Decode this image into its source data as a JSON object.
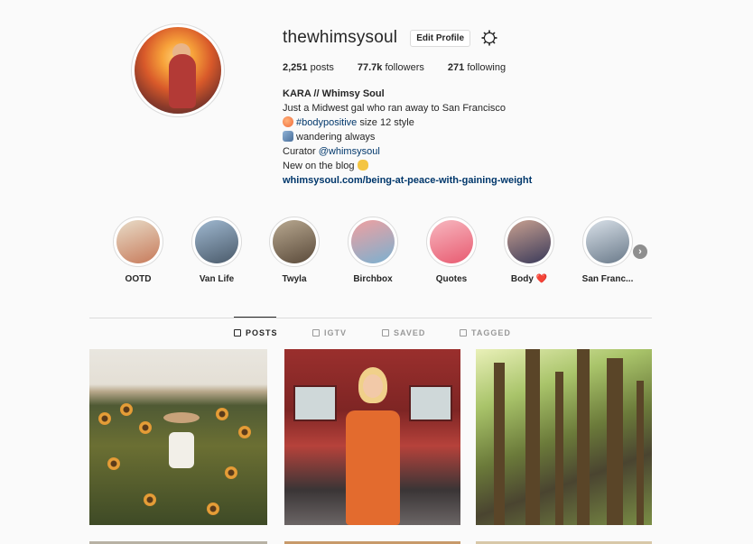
{
  "profile": {
    "username": "thewhimsysoul",
    "edit_label": "Edit Profile",
    "settings_icon": "gear-icon"
  },
  "stats": {
    "posts_count": "2,251",
    "posts_label": "posts",
    "followers_count": "77.7k",
    "followers_label": "followers",
    "following_count": "271",
    "following_label": "following"
  },
  "bio": {
    "name": "KARA // Whimsy Soul",
    "line1": "Just a Midwest gal who ran away to San Francisco",
    "line2_tag": "#bodypositive",
    "line2_rest": " size 12 style",
    "line3": "wandering always",
    "line4_prefix": "Curator ",
    "line4_mention": "@whimsysoul",
    "line5": "New on the blog",
    "link": "whimsysoul.com/being-at-peace-with-gaining-weight"
  },
  "highlights": [
    {
      "label": "OOTD",
      "colors": [
        "#e8dcc8",
        "#c77a5a"
      ]
    },
    {
      "label": "Van Life",
      "colors": [
        "#9fb8d0",
        "#4a5a6a"
      ]
    },
    {
      "label": "Twyla",
      "colors": [
        "#b8a890",
        "#5a4a3a"
      ]
    },
    {
      "label": "Birchbox",
      "colors": [
        "#f0a0a0",
        "#7ab0d0"
      ]
    },
    {
      "label": "Quotes",
      "colors": [
        "#f7b8c0",
        "#e85a70"
      ]
    },
    {
      "label": "Body ❤️",
      "colors": [
        "#c8a090",
        "#3a3a5a"
      ]
    },
    {
      "label": "San Franc...",
      "colors": [
        "#d8e0e8",
        "#6a7a8a"
      ]
    }
  ],
  "highlights_next_icon": "chevron-right-icon",
  "tabs": [
    {
      "label": "POSTS",
      "icon": "grid-icon",
      "active": true
    },
    {
      "label": "IGTV",
      "icon": "igtv-icon",
      "active": false
    },
    {
      "label": "SAVED",
      "icon": "bookmark-icon",
      "active": false
    },
    {
      "label": "TAGGED",
      "icon": "tag-icon",
      "active": false
    }
  ],
  "posts": [
    {
      "subject": "sunflower field photo"
    },
    {
      "subject": "orange dress by red van photo"
    },
    {
      "subject": "redwood forest photo"
    }
  ]
}
